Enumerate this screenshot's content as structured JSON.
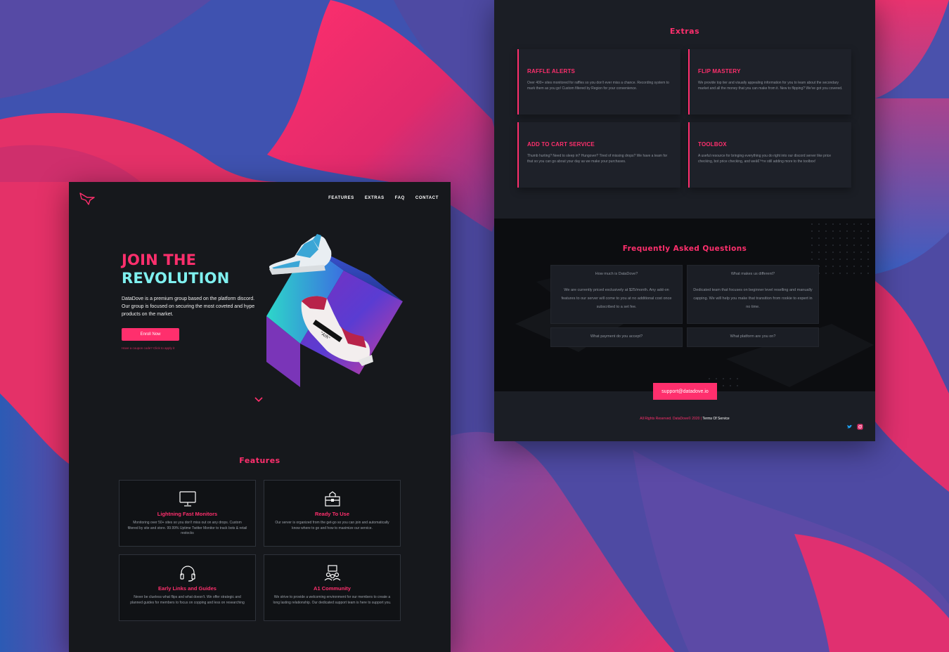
{
  "colors": {
    "accent": "#ff2f6d",
    "teal": "#7ff0ef",
    "panel": "#16181c",
    "panel_dark": "#1b1e25"
  },
  "landing": {
    "nav": {
      "items": [
        "FEATURES",
        "EXTRAS",
        "FAQ",
        "CONTACT"
      ]
    },
    "hero": {
      "title_line1": "JOIN THE",
      "title_line2": "REVOLUTION",
      "description": "DataDove is a premium group based on the platform discord. Our group is focused on securing the most coveted and hype products on the market.",
      "enroll_label": "Enroll Now",
      "redeem_link": "Have a coupon code? Click to apply it"
    },
    "features": {
      "title": "Features",
      "items": [
        {
          "icon": "monitor-icon",
          "title": "Lightning Fast Monitors",
          "desc": "Monitoring over 50+ sites so you don't miss out on any drops. Custom filtered by site and store. 99.99% Uptime Twitter Monitor to track bots & retail restocks"
        },
        {
          "icon": "toolbox-icon",
          "title": "Ready To Use",
          "desc": "Our server is organized from the get-go so you can join and automatically know where to go and how to maximize our service."
        },
        {
          "icon": "headset-icon",
          "title": "Early Links and Guides",
          "desc": "Never be clueless what flips and what doesn't. We offer strategic and planned guides for members to focus on copping and less on researching"
        },
        {
          "icon": "community-icon",
          "title": "A1 Community",
          "desc": "We strive to provide a welcoming environment for our members to create a long lasting relationship. Our dedicated support team is here to support you."
        }
      ]
    }
  },
  "detail": {
    "extras": {
      "title": "Extras",
      "items": [
        {
          "title": "RAFFLE ALERTS",
          "desc": "Over 400+ sites monitored for raffles so you don't ever miss a chance. Recording system to mark them as you go! Custom filtered by Region for your convenience."
        },
        {
          "title": "FLIP MASTERY",
          "desc": "We provide top tier and visually appealing information for you to learn about the secondary market and all the money that you can make from it. New to flipping? We've got you covered."
        },
        {
          "title": "ADD TO CART SERVICE",
          "desc": "Thumb hurting? Need to sleep in? Hungover? Tired of missing drops? We have a team for that so you can go about your day as we make your purchases."
        },
        {
          "title": "TOOLBOX",
          "desc": "A useful resource for bringing everything you do right into our discord server like price checking, bot price checking, and weâ€™re still adding more to the toolbox!"
        }
      ]
    },
    "faq": {
      "title": "Frequently Asked Questions",
      "items": [
        {
          "q": "How much is DataDove?",
          "a": "We are currently priced exclusively at $25/month. Any add-on features to our server will come to you at no additional cost once subscribed to a set fee."
        },
        {
          "q": "What makes us different?",
          "a": "Dedicated team that focuses on beginner level reselling and manually capping. We will help you make that transition from rookie to expert in no time."
        },
        {
          "q": "What payment do you accept?",
          "a": ""
        },
        {
          "q": "What platform are you on?",
          "a": ""
        }
      ]
    },
    "contact_email": "support@datadove.io",
    "footer": {
      "copyright": "All Rights Reserved. DataDove© 2020 | ",
      "terms": "Terms Of Service"
    }
  }
}
